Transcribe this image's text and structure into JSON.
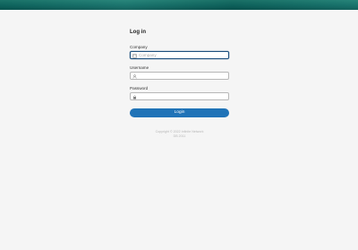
{
  "colors": {
    "banner": "#0f6d66",
    "background": "#f5f5f5",
    "button": "#1f73b7",
    "focus_border": "#1c4f7d"
  },
  "login": {
    "title": "Log in",
    "company": {
      "label": "Company",
      "placeholder": "Company",
      "value": "",
      "icon": "building-icon"
    },
    "username": {
      "label": "Username",
      "value": "",
      "icon": "user-icon"
    },
    "password": {
      "label": "Password",
      "value": "",
      "icon": "lock-icon"
    },
    "button_label": "Login"
  },
  "footer": {
    "line1": "Copyright © 2022 Infinite Network ",
    "line2": "DB 2011"
  }
}
